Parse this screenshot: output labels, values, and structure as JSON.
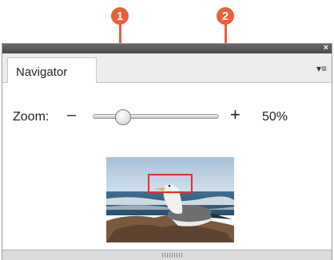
{
  "callouts": [
    "1",
    "2"
  ],
  "panel": {
    "tab_label": "Navigator",
    "close_glyph": "×",
    "menu_glyph": "▾≡"
  },
  "zoom": {
    "label": "Zoom:",
    "minus": "–",
    "plus": "+",
    "value": "50%",
    "slider_level": 0.2
  },
  "icons": [
    "close-icon",
    "panel-menu-icon",
    "zoom-out-icon",
    "zoom-in-icon",
    "resize-grip-icon"
  ],
  "colors": {
    "callout": "#e8603c",
    "view_rectangle": "#e03030"
  }
}
